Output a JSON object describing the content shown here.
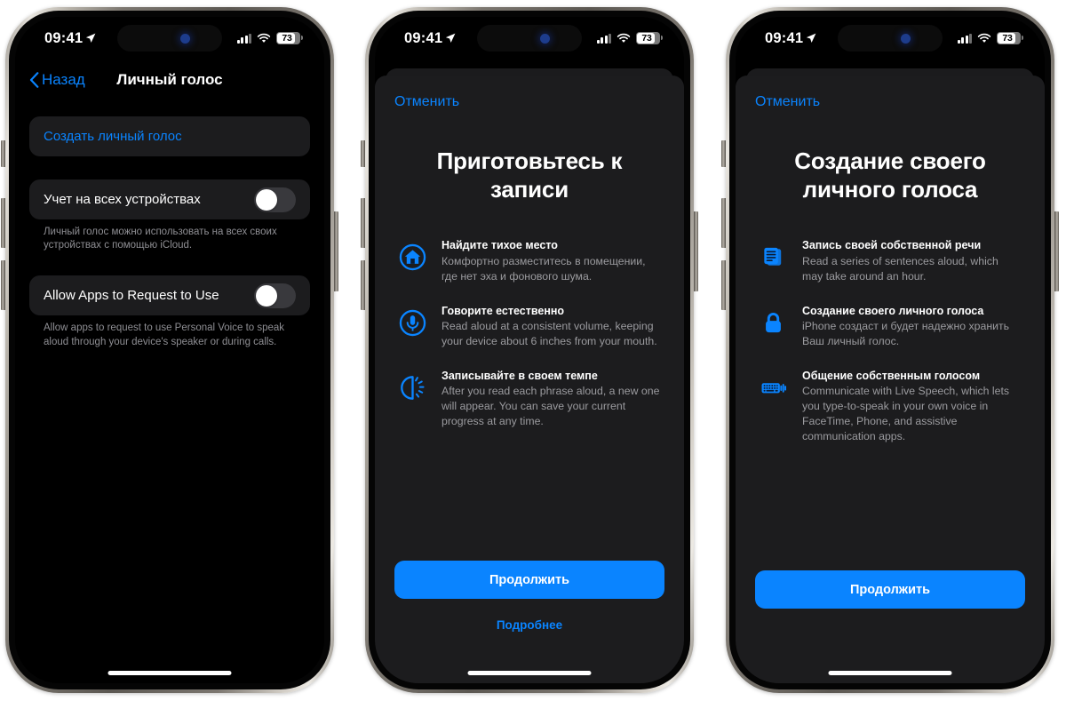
{
  "status_bar": {
    "time": "09:41",
    "battery_level": "73",
    "location_icon": "location-arrow-icon",
    "cellular_icon": "cellular-bars-icon",
    "wifi_icon": "wifi-icon",
    "battery_icon": "battery-icon"
  },
  "phone1": {
    "nav": {
      "back_label": "Назад",
      "title": "Личный голос"
    },
    "create_row": {
      "label": "Создать личный голос"
    },
    "rows": [
      {
        "label": "Учет на всех устройствах",
        "toggle_state": "off",
        "footnote": "Личный голос можно использовать на всех своих устройствах с помощью iCloud."
      },
      {
        "label": "Allow Apps to Request to Use",
        "toggle_state": "off",
        "footnote": "Allow apps to request to use Personal Voice to speak aloud through your device's speaker or during calls."
      }
    ]
  },
  "phone2": {
    "cancel_label": "Отменить",
    "title": "Приготовьтесь к записи",
    "features": [
      {
        "icon": "house-circle-icon",
        "head": "Найдите тихое место",
        "desc": "Комфортно разместитесь в помещении, где нет эха и фонового шума."
      },
      {
        "icon": "microphone-circle-icon",
        "head": "Говорите естественно",
        "desc": "Read aloud at a consistent volume, keeping your device about 6 inches from your mouth."
      },
      {
        "icon": "timer-rays-icon",
        "head": "Записывайте в своем темпе",
        "desc": "After you read each phrase aloud, a new one will appear. You can save your current progress at any time."
      }
    ],
    "primary_button": "Продолжить",
    "secondary_button": "Подробнее"
  },
  "phone3": {
    "cancel_label": "Отменить",
    "title": "Создание своего личного голоса",
    "features": [
      {
        "icon": "text-document-icon",
        "head": "Запись своей собственной речи",
        "desc": "Read a series of sentences aloud, which may take around an hour."
      },
      {
        "icon": "lock-icon",
        "head": "Создание своего личного голоса",
        "desc": "iPhone создаст и будет надежно хранить Ваш личный голос."
      },
      {
        "icon": "keyboard-waves-icon",
        "head": "Общение собственным голосом",
        "desc": "Communicate with Live Speech, which lets you type-to-speak in your own voice in FaceTime, Phone, and assistive communication apps."
      }
    ],
    "primary_button": "Продолжить"
  },
  "colors": {
    "accent_blue": "#0a84ff",
    "sheet_bg": "#1c1c1e",
    "screen_bg": "#000000",
    "secondary_text": "#8e8e93"
  }
}
